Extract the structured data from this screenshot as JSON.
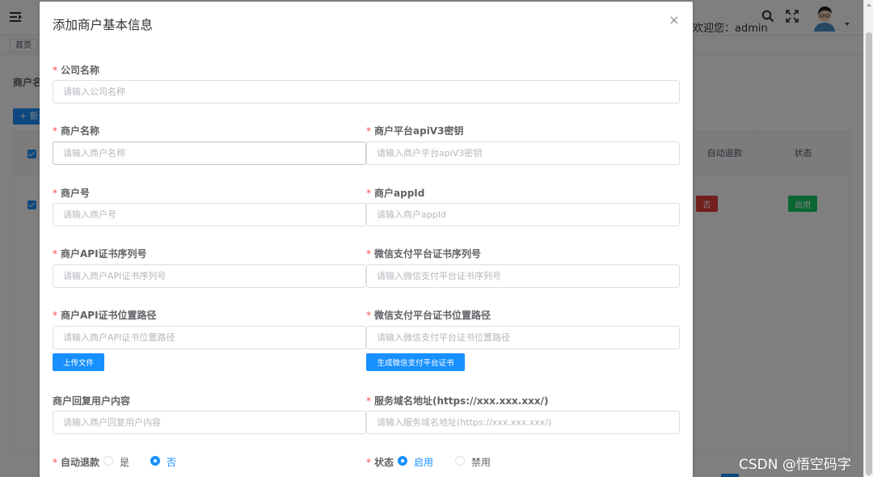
{
  "app": {
    "welcome": "欢迎您：admin",
    "tag_home": "首页",
    "shop_label": "商户名",
    "new_button": "+ 新",
    "table_headers": {
      "auto_refund": "自动退款",
      "status": "状态"
    },
    "row": {
      "auto_refund": "否",
      "status": "启用"
    }
  },
  "dialog": {
    "title": "添加商户基本信息",
    "close": "×",
    "fields": {
      "company": {
        "label": "公司名称",
        "placeholder": "请输入公司名称"
      },
      "merchant_name": {
        "label": "商户名称",
        "placeholder": "请输入商户名称"
      },
      "apiv3_key": {
        "label": "商户平台apiV3密钥",
        "placeholder": "请输入商户平台apiV3密钥"
      },
      "merchant_no": {
        "label": "商户号",
        "placeholder": "请输入商户号"
      },
      "appid": {
        "label": "商户appId",
        "placeholder": "请输入商户appId"
      },
      "api_cert_serial": {
        "label": "商户API证书序列号",
        "placeholder": "请输入商户API证书序列号"
      },
      "wx_cert_serial": {
        "label": "微信支付平台证书序列号",
        "placeholder": "请输入微信支付平台证书序列号"
      },
      "api_cert_path": {
        "label": "商户API证书位置路径",
        "placeholder": "请输入商户API证书位置路径"
      },
      "wx_cert_path": {
        "label": "微信支付平台证书位置路径",
        "placeholder": "请输入微信支付平台证书位置路径"
      },
      "reply_content": {
        "label": "商户回复用户内容",
        "placeholder": "请输入商户回复用户内容"
      },
      "domain": {
        "label": "服务域名地址(https://xxx.xxx.xxx/)",
        "placeholder": "请输入服务域名地址(https://xxx.xxx.xxx/)"
      }
    },
    "upload_button": "上传文件",
    "generate_button": "生成微信支付平台证书",
    "auto_refund": {
      "label": "自动退款",
      "options": [
        "是",
        "否"
      ],
      "selected": "否"
    },
    "status": {
      "label": "状态",
      "options": [
        "启用",
        "禁用"
      ],
      "selected": "启用"
    }
  },
  "watermark": "CSDN @悟空码字",
  "colors": {
    "primary": "#1890ff",
    "required": "#ff4949",
    "danger": "#e23c39",
    "success": "#13ce66"
  }
}
